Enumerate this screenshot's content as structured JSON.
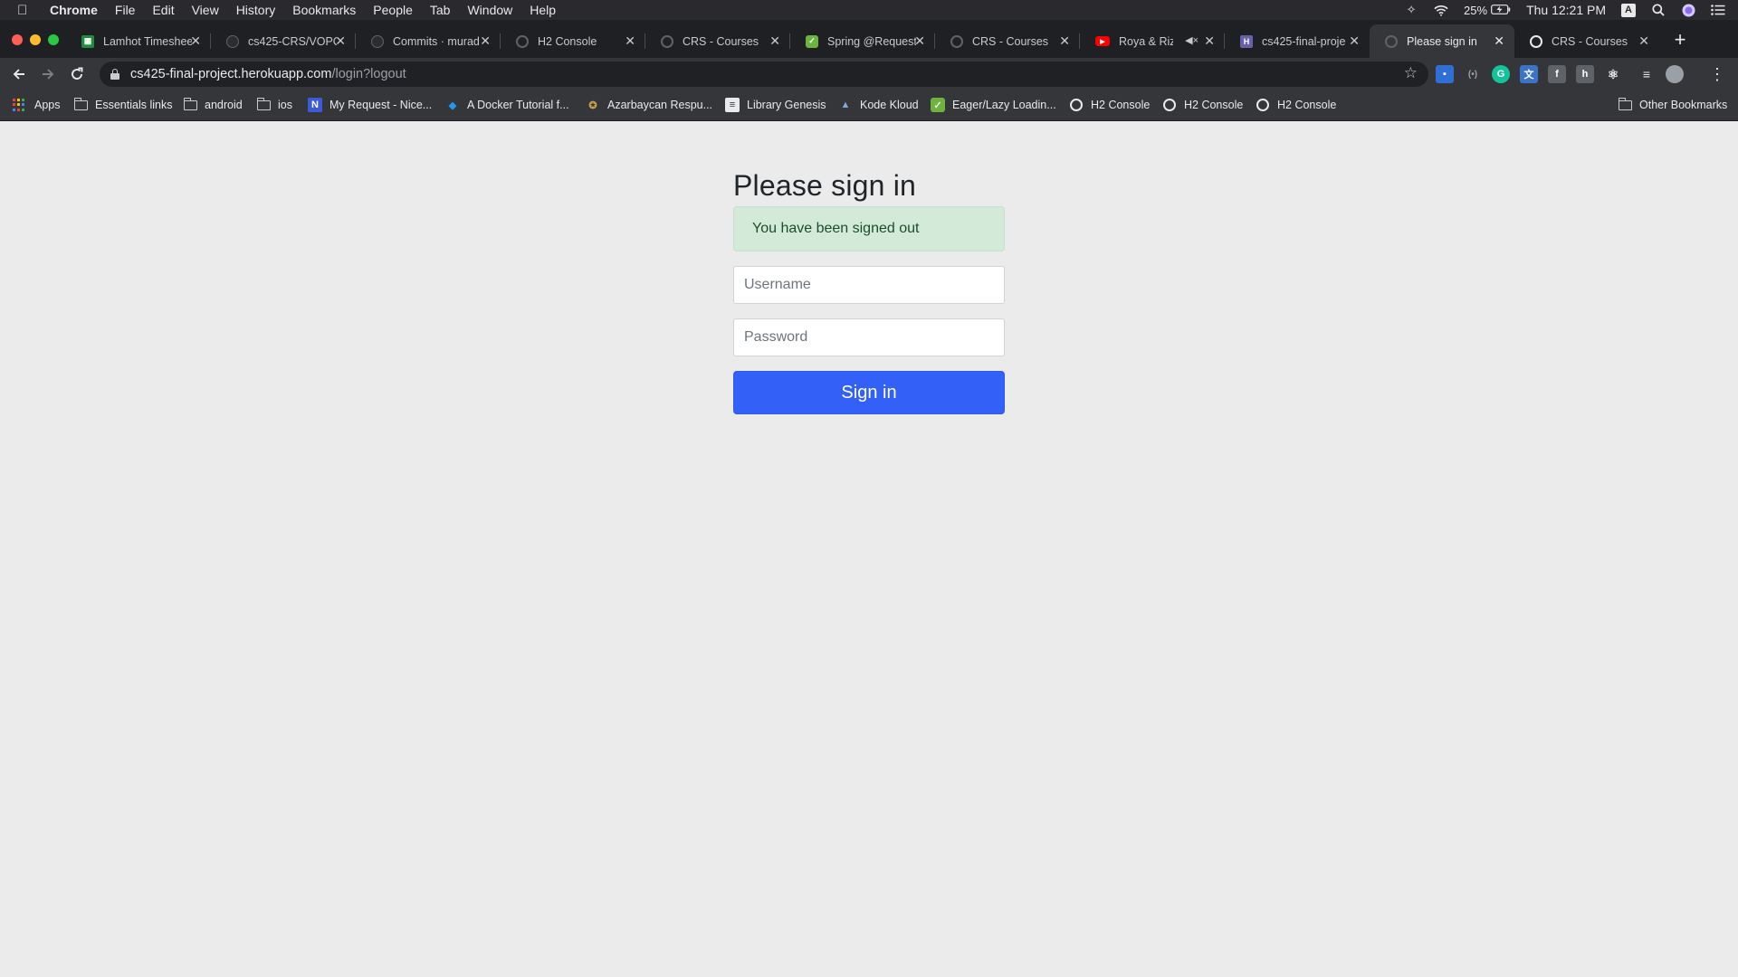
{
  "menubar": {
    "app_name": "Chrome",
    "items": [
      "File",
      "Edit",
      "View",
      "History",
      "Bookmarks",
      "People",
      "Tab",
      "Window",
      "Help"
    ],
    "battery": "25%",
    "clock": "Thu 12:21 PM",
    "input_source": "A"
  },
  "tabs": [
    {
      "title": "Lamhot Timesheet",
      "favicon": "sheets-icon",
      "color": "#1e8e3e"
    },
    {
      "title": "cs425-CRS/VOPC",
      "favicon": "github-icon",
      "color": "#2b2d31"
    },
    {
      "title": "Commits · murad",
      "favicon": "github-icon",
      "color": "#2b2d31"
    },
    {
      "title": "H2 Console",
      "favicon": "globe-icon",
      "color": "#5f6368"
    },
    {
      "title": "CRS - Courses",
      "favicon": "globe-icon",
      "color": "#5f6368"
    },
    {
      "title": "Spring @RequestB",
      "favicon": "spring-icon",
      "color": "#6db33f"
    },
    {
      "title": "CRS - Courses",
      "favicon": "globe-icon",
      "color": "#5f6368"
    },
    {
      "title": "Roya & Rizvan",
      "favicon": "youtube-icon",
      "color": "#ff0000"
    },
    {
      "title": "cs425-final-proje",
      "favicon": "heroku-icon",
      "color": "#6762a6"
    },
    {
      "title": "Please sign in",
      "favicon": "globe-icon",
      "color": "#5f6368"
    },
    {
      "title": "CRS - Courses",
      "favicon": "globe-icon",
      "color": "#e8eaed"
    }
  ],
  "address_bar": {
    "host": "cs425-final-project.herokuapp.com",
    "path": "/login?logout"
  },
  "bookmarks": [
    {
      "label": "Apps",
      "type": "apps"
    },
    {
      "label": "Essentials links",
      "type": "folder"
    },
    {
      "label": "android",
      "type": "folder"
    },
    {
      "label": "ios",
      "type": "folder"
    },
    {
      "label": "My Request - Nice...",
      "type": "site",
      "icon_text": "N",
      "color": "#3b5bdb"
    },
    {
      "label": "A Docker Tutorial f...",
      "type": "site",
      "icon_text": "◆",
      "color": "#2496ed"
    },
    {
      "label": "Azarbaycan Respu...",
      "type": "site",
      "icon_text": "✪",
      "color": "#c9a24b"
    },
    {
      "label": "Library Genesis",
      "type": "site",
      "icon_text": "≡",
      "color": "#e8eaed"
    },
    {
      "label": "Kode Kloud",
      "type": "site",
      "icon_text": "▲",
      "color": "#7fa8d9"
    },
    {
      "label": "Eager/Lazy Loadin...",
      "type": "site",
      "icon_text": "✓",
      "color": "#6db33f"
    },
    {
      "label": "H2 Console",
      "type": "globe"
    },
    {
      "label": "H2 Console",
      "type": "globe"
    },
    {
      "label": "H2 Console",
      "type": "globe"
    }
  ],
  "other_bookmarks": "Other Bookmarks",
  "login": {
    "heading": "Please sign in",
    "alert": "You have been signed out",
    "username_placeholder": "Username",
    "password_placeholder": "Password",
    "submit_label": "Sign in"
  },
  "colors": {
    "primary_button": "#3360f6",
    "alert_bg": "#d4ead9",
    "page_bg": "#ebebeb"
  }
}
